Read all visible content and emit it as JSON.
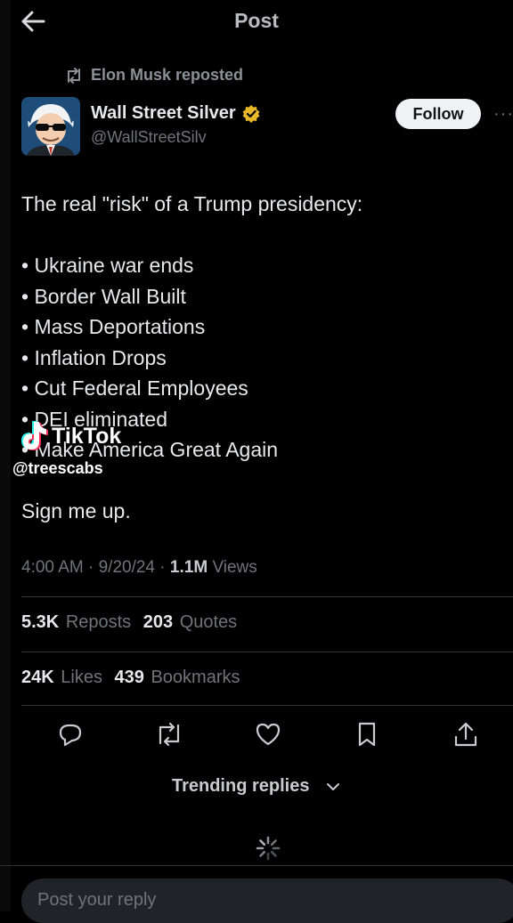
{
  "header": {
    "title": "Post"
  },
  "repost": {
    "text": "Elon Musk reposted"
  },
  "author": {
    "name": "Wall Street Silver",
    "handle": "@WallStreetSilv",
    "follow_label": "Follow"
  },
  "post": {
    "intro": "The real \"risk\" of a Trump presidency:",
    "bullets": [
      "• Ukraine war ends",
      "• Border Wall Built",
      "• Mass Deportations",
      "• Inflation Drops",
      "• Cut Federal Employees",
      "• DEI eliminated",
      "• Make America Great Again"
    ],
    "outro": "Sign me up."
  },
  "meta": {
    "time": "4:00 AM",
    "date": "9/20/24",
    "views_count": "1.1M",
    "views_label": "Views"
  },
  "stats": {
    "reposts_count": "5.3K",
    "reposts_label": "Reposts",
    "quotes_count": "203",
    "quotes_label": "Quotes",
    "likes_count": "24K",
    "likes_label": "Likes",
    "bookmarks_count": "439",
    "bookmarks_label": "Bookmarks"
  },
  "watermark": {
    "brand": "TikTok",
    "user": "@treescabs"
  },
  "trending": {
    "label": "Trending replies"
  },
  "reply": {
    "placeholder": "Post your reply"
  },
  "icons": {
    "back": "arrow-left-icon",
    "repost": "repost-icon",
    "verified": "verified-badge-icon",
    "more": "more-icon",
    "reply": "reply-icon",
    "like": "heart-icon",
    "bookmark": "bookmark-icon",
    "share": "share-icon",
    "spinner": "loading-spinner-icon"
  },
  "colors": {
    "background": "#000000",
    "text": "#e7e9ea",
    "muted": "#6f7479",
    "verified": "#e8b829"
  }
}
